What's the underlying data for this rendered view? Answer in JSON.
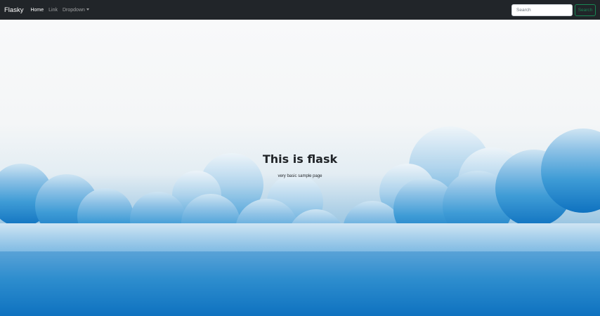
{
  "navbar": {
    "brand": "Flasky",
    "links": [
      {
        "label": "Home"
      },
      {
        "label": "Link"
      },
      {
        "label": "Dropdown"
      }
    ],
    "search": {
      "placeholder": "Search",
      "button_label": "Search"
    }
  },
  "hero": {
    "title": "This is flask",
    "subtitle": "very basic sample page"
  },
  "colors": {
    "navbar_bg": "#212529",
    "accent_success": "#198754",
    "sky_blue": "#1a7ec9"
  }
}
